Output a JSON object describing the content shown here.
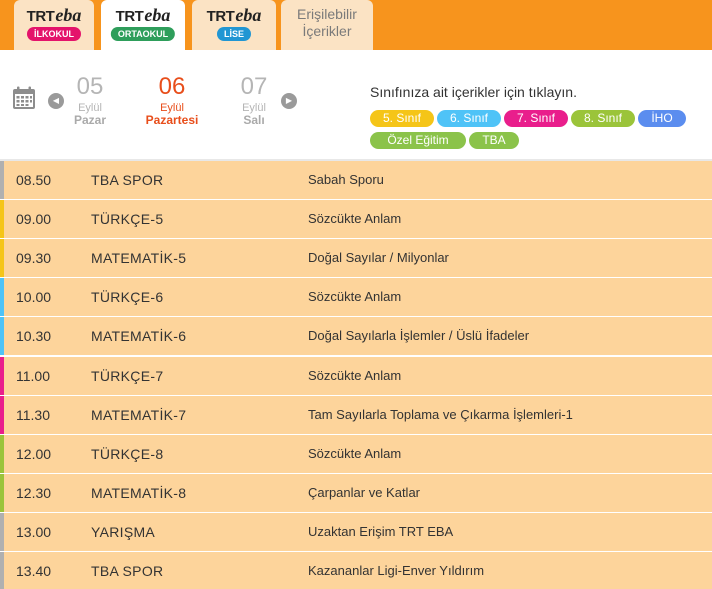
{
  "tabs": [
    {
      "brand_trt": "TRT",
      "brand_eba": "eba",
      "level": "İLKOKUL",
      "level_color": "#e4136b",
      "active": false
    },
    {
      "brand_trt": "TRT",
      "brand_eba": "eba",
      "level": "ORTAOKUL",
      "level_color": "#2e9e5b",
      "active": true
    },
    {
      "brand_trt": "TRT",
      "brand_eba": "eba",
      "level": "LİSE",
      "level_color": "#2196d3",
      "active": false
    }
  ],
  "accessible_tab": {
    "line1": "Erişilebilir",
    "line2": "İçerikler"
  },
  "dates": [
    {
      "day": "05",
      "month": "Eylül",
      "weekday": "Pazar",
      "selected": false
    },
    {
      "day": "06",
      "month": "Eylül",
      "weekday": "Pazartesi",
      "selected": true
    },
    {
      "day": "07",
      "month": "Eylül",
      "weekday": "Salı",
      "selected": false
    }
  ],
  "hint": "Sınıfınıza ait içerikler için tıklayın.",
  "chips": [
    {
      "label": "5. Sınıf",
      "color": "#f5c518"
    },
    {
      "label": "6. Sınıf",
      "color": "#4fc3f7"
    },
    {
      "label": "7. Sınıf",
      "color": "#e91e8c"
    },
    {
      "label": "8. Sınıf",
      "color": "#9bc43a"
    },
    {
      "label": "İHO",
      "color": "#5b8def"
    },
    {
      "label": "Özel Eğitim",
      "color": "#8bc34a"
    },
    {
      "label": "TBA",
      "color": "#8bc34a"
    }
  ],
  "schedule": [
    {
      "time": "08.50",
      "course": "TBA SPOR",
      "topic": "Sabah Sporu",
      "accent": "#b0b0b0"
    },
    {
      "time": "09.00",
      "course": "TÜRKÇE-5",
      "topic": "Sözcükte Anlam",
      "accent": "#f5c518"
    },
    {
      "time": "09.30",
      "course": "MATEMATİK-5",
      "topic": "Doğal Sayılar / Milyonlar",
      "accent": "#f5c518"
    },
    {
      "time": "10.00",
      "course": "TÜRKÇE-6",
      "topic": "Sözcükte Anlam",
      "accent": "#4fc3f7"
    },
    {
      "time": "10.30",
      "course": "MATEMATİK-6",
      "topic": "Doğal Sayılarla İşlemler / Üslü İfadeler",
      "accent": "#4fc3f7"
    },
    {
      "time": "11.00",
      "course": "TÜRKÇE-7",
      "topic": "Sözcükte Anlam",
      "accent": "#e91e8c"
    },
    {
      "time": "11.30",
      "course": "MATEMATİK-7",
      "topic": "Tam Sayılarla Toplama ve Çıkarma İşlemleri-1",
      "accent": "#e91e8c"
    },
    {
      "time": "12.00",
      "course": "TÜRKÇE-8",
      "topic": "Sözcükte Anlam",
      "accent": "#9bc43a"
    },
    {
      "time": "12.30",
      "course": "MATEMATİK-8",
      "topic": "Çarpanlar ve Katlar",
      "accent": "#9bc43a"
    },
    {
      "time": "13.00",
      "course": "YARIŞMA",
      "topic": "Uzaktan Erişim TRT EBA",
      "accent": "#b0b0b0"
    },
    {
      "time": "13.40",
      "course": "TBA SPOR",
      "topic": "Kazananlar Ligi-Enver Yıldırım",
      "accent": "#b0b0b0"
    }
  ],
  "icons": {
    "calendar": "calendar-icon",
    "prev": "chevron-left-icon",
    "next": "chevron-right-icon"
  }
}
